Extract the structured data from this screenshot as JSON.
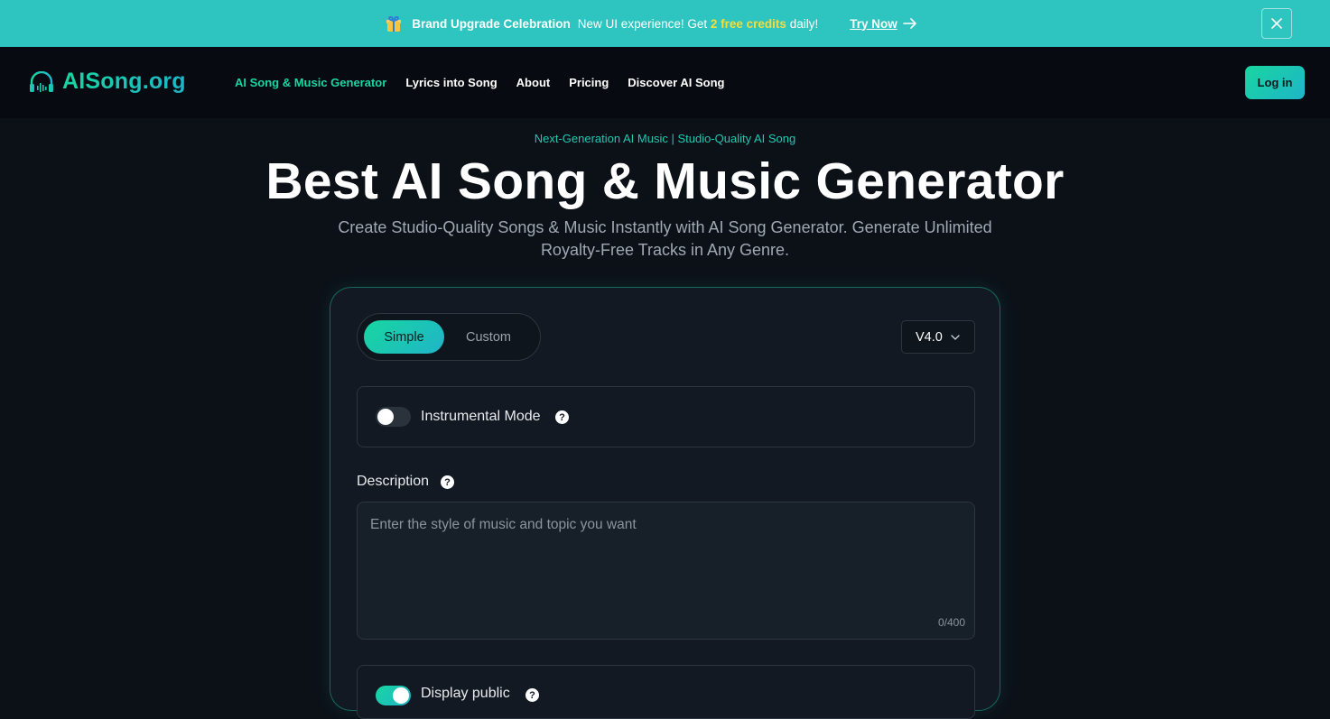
{
  "announcement": {
    "title": "Brand Upgrade Celebration",
    "text_before": "New UI experience! Get",
    "highlight": "2 free credits",
    "text_after": "daily!",
    "cta": "Try Now",
    "gift_icon": "gift-icon",
    "close_icon": "close-icon"
  },
  "nav": {
    "logo": "AISong.org",
    "logo_icon": "headphones-icon",
    "links": [
      {
        "label": "AI Song & Music Generator",
        "active": true
      },
      {
        "label": "Lyrics into Song"
      },
      {
        "label": "About"
      },
      {
        "label": "Pricing"
      },
      {
        "label": "Discover AI Song"
      }
    ],
    "login": "Log in"
  },
  "hero": {
    "eyebrow": "Next-Generation AI Music | Studio-Quality AI Song",
    "title": "Best AI Song & Music Generator",
    "subtitle": "Create Studio-Quality Songs & Music Instantly with AI Song Generator. Generate Unlimited Royalty-Free Tracks in Any Genre."
  },
  "form": {
    "modes": [
      "Simple",
      "Custom"
    ],
    "selected_mode": "Simple",
    "version": "V4.0",
    "instrumental_label": "Instrumental Mode",
    "instrumental_on": false,
    "description_label": "Description",
    "description_placeholder": "Enter the style of music and topic you want",
    "description_value": "",
    "counter": "0/400",
    "public_label": "Display public",
    "public_on": true
  },
  "colors": {
    "accent": "#18d6a0",
    "accent2": "#1fb5c8",
    "banner": "#2ec4bf",
    "highlight": "#f7dd3c",
    "background": "#0c1118"
  }
}
